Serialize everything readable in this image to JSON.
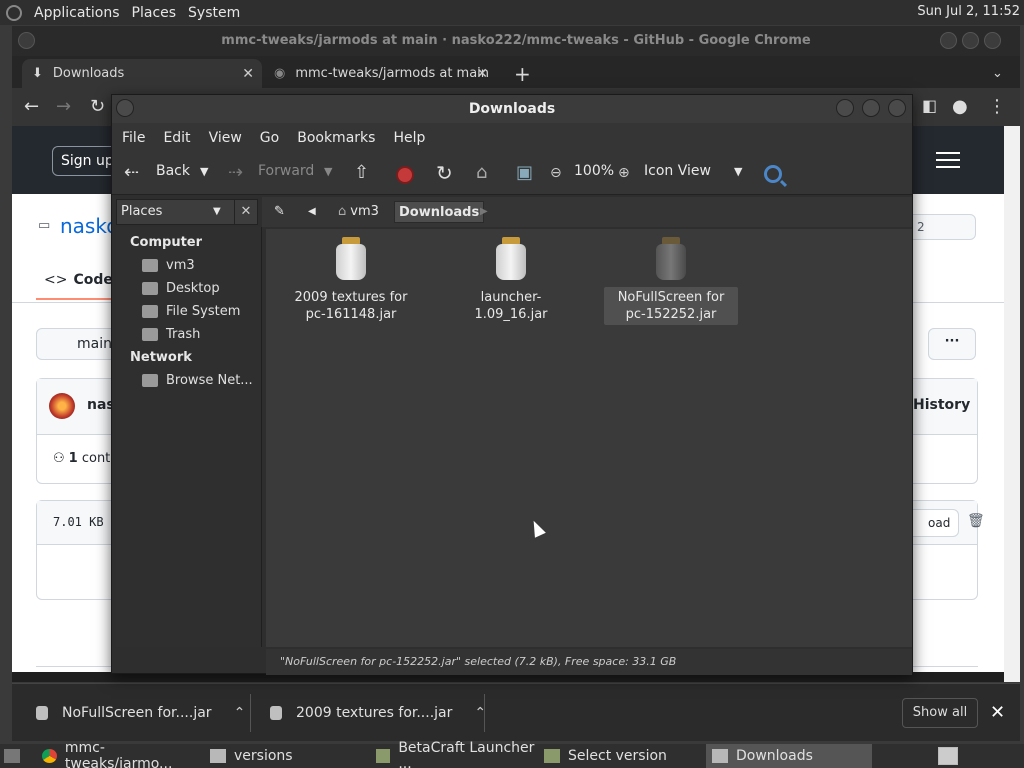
{
  "top_panel": {
    "menus": [
      "Applications",
      "Places",
      "System"
    ],
    "clock": "Sun Jul  2, 11:52"
  },
  "chrome": {
    "window_title": "mmc-tweaks/jarmods at main · nasko222/mmc-tweaks - GitHub - Google Chrome",
    "tabs": [
      {
        "label": "Downloads"
      },
      {
        "label": "mmc-tweaks/jarmods at main"
      }
    ]
  },
  "github": {
    "sign_up": "Sign up",
    "repo_name": "nasko",
    "code_tab": "Code",
    "count": "2",
    "branch": "main",
    "more": "···",
    "user": "nas",
    "history": "History",
    "contributors_count": "1",
    "contributors_text": "cont",
    "file_size": "7.01 KB",
    "download": "oad"
  },
  "downloads_bar": {
    "items": [
      {
        "label": "NoFullScreen for....jar"
      },
      {
        "label": "2009 textures for....jar"
      }
    ],
    "show_all": "Show all"
  },
  "taskbar": {
    "items": [
      {
        "label": "mmc-tweaks/jarmo..."
      },
      {
        "label": "versions"
      },
      {
        "label": "BetaCraft Launcher ..."
      },
      {
        "label": "Select version"
      },
      {
        "label": "Downloads"
      }
    ]
  },
  "file_manager": {
    "title": "Downloads",
    "menus": [
      "File",
      "Edit",
      "View",
      "Go",
      "Bookmarks",
      "Help"
    ],
    "toolbar": {
      "back": "Back",
      "forward": "Forward",
      "zoom": "100%",
      "view_mode": "Icon View"
    },
    "sidebar": {
      "header": "Places",
      "sections": [
        {
          "title": "Computer",
          "items": [
            "vm3",
            "Desktop",
            "File System",
            "Trash"
          ]
        },
        {
          "title": "Network",
          "items": [
            "Browse Net..."
          ]
        }
      ]
    },
    "path": [
      "vm3",
      "Downloads"
    ],
    "files": [
      {
        "name": "2009 textures for pc-161148.jar",
        "selected": false
      },
      {
        "name": "launcher-1.09_16.jar",
        "selected": false
      },
      {
        "name": "NoFullScreen for pc-152252.jar",
        "selected": true
      }
    ],
    "status": "\"NoFullScreen for pc-152252.jar\" selected (7.2 kB), Free space: 33.1 GB"
  }
}
